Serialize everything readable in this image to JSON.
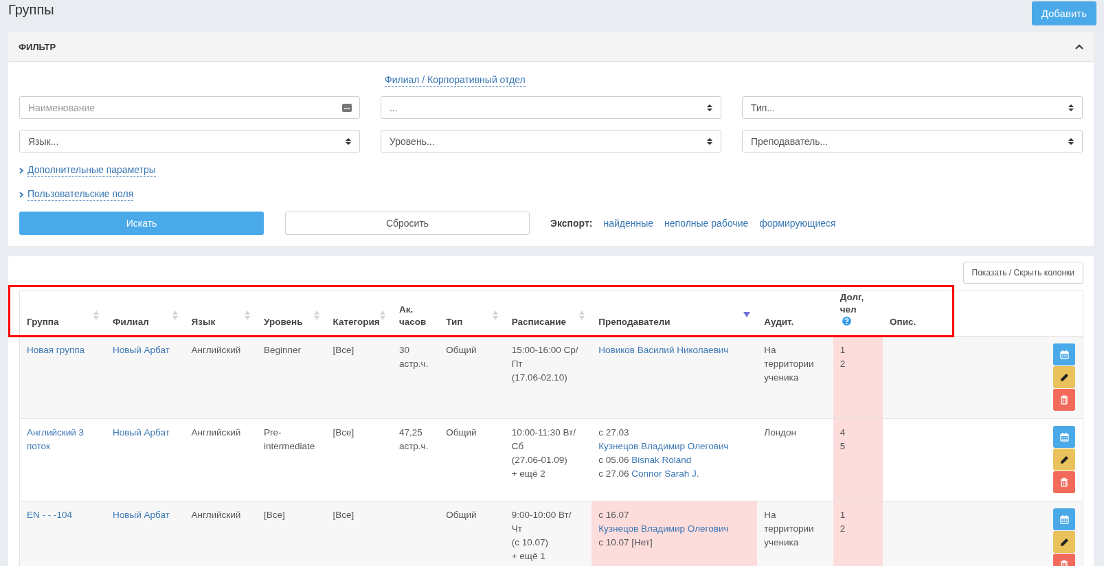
{
  "page": {
    "title": "Группы",
    "add_button": "Добавить"
  },
  "filter": {
    "title": "ФИЛЬТР",
    "expanded": true,
    "branch_label": "Филиал / Корпоративный отдел",
    "fields": [
      {
        "kind": "input",
        "placeholder": "Наименование"
      },
      {
        "kind": "select",
        "value": "..."
      },
      {
        "kind": "select",
        "value": "Тип..."
      },
      {
        "kind": "select",
        "value": "Язык..."
      },
      {
        "kind": "select",
        "value": "Уровень..."
      },
      {
        "kind": "select",
        "value": "Преподаватель..."
      }
    ],
    "links": [
      "Дополнительные параметры",
      "Пользовательские поля"
    ],
    "search_button": "Искать",
    "reset_button": "Сбросить",
    "export_label": "Экспорт:",
    "export_links": [
      "найденные",
      "неполные рабочие",
      "формирующиеся"
    ]
  },
  "table": {
    "toggle_columns_button": "Показать / Скрыть колонки",
    "highlight_header": true,
    "columns": [
      {
        "label": "Группа",
        "sortable": true
      },
      {
        "label": "Филиал",
        "sortable": true
      },
      {
        "label": "Язык",
        "sortable": true
      },
      {
        "label": "Уровень",
        "sortable": true
      },
      {
        "label": "Категория",
        "sortable": true
      },
      {
        "label": "Ак. часов"
      },
      {
        "label": "Тип",
        "sortable": true
      },
      {
        "label": "Расписание",
        "sortable": true
      },
      {
        "label": "Преподаватели",
        "sorted_descending": true
      },
      {
        "label": "Аудит."
      },
      {
        "label": "Долг, чел",
        "help": true
      },
      {
        "label": "Опис."
      }
    ],
    "rows": [
      {
        "group": "Новая группа",
        "branch": "Новый Арбат",
        "language": "Английский",
        "level": "Beginner",
        "category": "[Все]",
        "hours": "30 астр.ч.",
        "type": "Общий",
        "schedule": [
          "15:00-16:00 Ср/",
          "Пт",
          "(17.06-02.10)"
        ],
        "teachers": [
          {
            "name": "Новиков Василий Николаевич",
            "linked": true
          }
        ],
        "teachers_highlight": false,
        "room": "На территории ученика",
        "debt": [
          "1",
          "2"
        ],
        "debt_highlight": true
      },
      {
        "group": "Английский 3 поток",
        "branch": "Новый Арбат",
        "language": "Английский",
        "level": "Pre-intermediate",
        "category": "[Все]",
        "hours": "47,25 астр.ч.",
        "type": "Общий",
        "schedule": [
          "10:00-11:30 Вт/",
          "Сб",
          "(27.06-01.09)",
          "+ ещё 2"
        ],
        "teachers": [
          {
            "since": "с 27.03",
            "name": "Кузнецов Владимир Олегович",
            "linked": true
          },
          {
            "since": "с 05.06",
            "name": "Bisnak Roland",
            "linked": true
          },
          {
            "since": "с 27.06",
            "name": "Connor Sarah J.",
            "linked": true
          }
        ],
        "teachers_highlight": false,
        "room": "Лондон",
        "debt": [
          "4",
          "5"
        ],
        "debt_highlight": true
      },
      {
        "group": "EN - - -104",
        "branch": "Новый Арбат",
        "language": "Английский",
        "level": "[Все]",
        "category": "[Все]",
        "type": "Общий",
        "schedule": [
          "9:00-10:00 Вт/",
          "Чт",
          "(с 10.07)",
          "+ ещё 1"
        ],
        "teachers": [
          {
            "since": "с 16.07",
            "name": "Кузнецов Владимир Олегович",
            "linked": true
          },
          {
            "since": "с 10.07",
            "name": "[Нет]",
            "linked": false
          }
        ],
        "teachers_highlight": true,
        "room": "На территории ученика",
        "debt": [
          "1",
          "2"
        ],
        "debt_highlight": true
      }
    ]
  }
}
